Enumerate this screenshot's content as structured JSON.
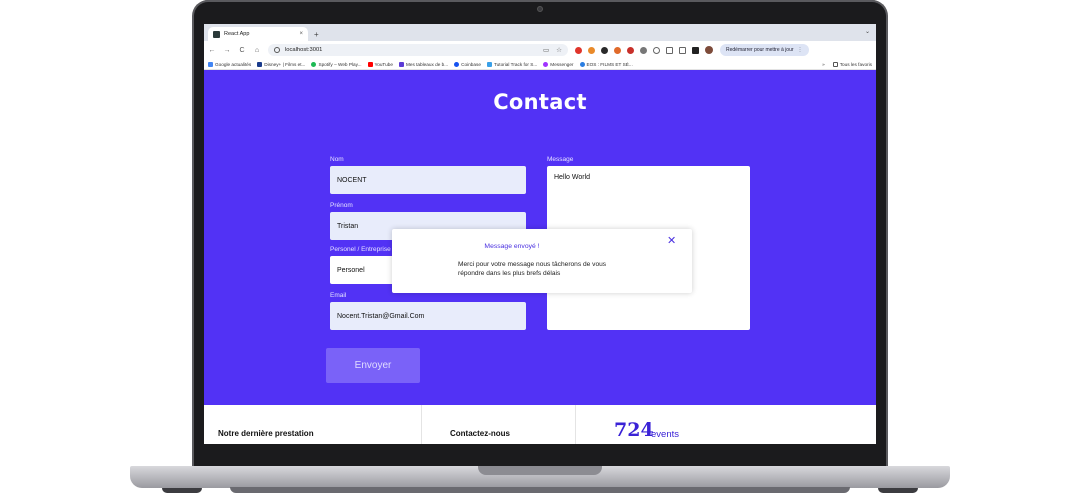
{
  "browser": {
    "tab_title": "React App",
    "tab_close": "×",
    "new_tab": "+",
    "tabstrip_menu": "⌄",
    "nav": {
      "back": "←",
      "forward": "→",
      "reload": "C",
      "home": "⌂"
    },
    "url": "localhost:3001",
    "restart_label": "Redémarrer pour mettre à jour",
    "menu_label": "⋮"
  },
  "bookmarks": {
    "items": [
      {
        "label": "Google actualités",
        "icon": "google-news-icon",
        "color": "#4285f4"
      },
      {
        "label": "Disney+ | Films et...",
        "icon": "disney-icon",
        "color": "#1a3b8c"
      },
      {
        "label": "Spotify – Web Play...",
        "icon": "spotify-icon",
        "color": "#1db954"
      },
      {
        "label": "YouTube",
        "icon": "youtube-icon",
        "color": "#ff0000"
      },
      {
        "label": "Mes tableaux de b...",
        "icon": "trello-icon",
        "color": "#5c3bd6"
      },
      {
        "label": "Coinbase",
        "icon": "coinbase-icon",
        "color": "#1652f0"
      },
      {
        "label": "Tutorial Track for S...",
        "icon": "tutorial-icon",
        "color": "#3aa0e8"
      },
      {
        "label": "Messenger",
        "icon": "messenger-icon",
        "color": "#a033ff"
      },
      {
        "label": "EOS : FILMS ET SÉ...",
        "icon": "eos-icon",
        "color": "#2a7de1"
      }
    ],
    "more": "»",
    "all_label": "Tous les favoris"
  },
  "contact": {
    "title": "Contact",
    "labels": {
      "nom": "Nom",
      "prenom": "Prénom",
      "type": "Personel / Entreprise",
      "email": "Email",
      "message": "Message"
    },
    "values": {
      "nom": "NOCENT",
      "prenom": "Tristan",
      "type": "Personel",
      "email": "Nocent.Tristan@Gmail.Com",
      "message": "Hello World"
    },
    "send_label": "Envoyer"
  },
  "modal": {
    "title": "Message envoyé !",
    "message": "Merci pour votre message nous tâcherons de vous répondre dans les plus brefs délais",
    "close": "✕"
  },
  "footer": {
    "last_work": "Notre dernière prestation",
    "contact_us": "Contactez-nous",
    "events_count": "724",
    "events_label": "events"
  },
  "colors": {
    "accent": "#5232f5",
    "button": "#7a62f8",
    "input_bg": "#e8ecfb"
  }
}
